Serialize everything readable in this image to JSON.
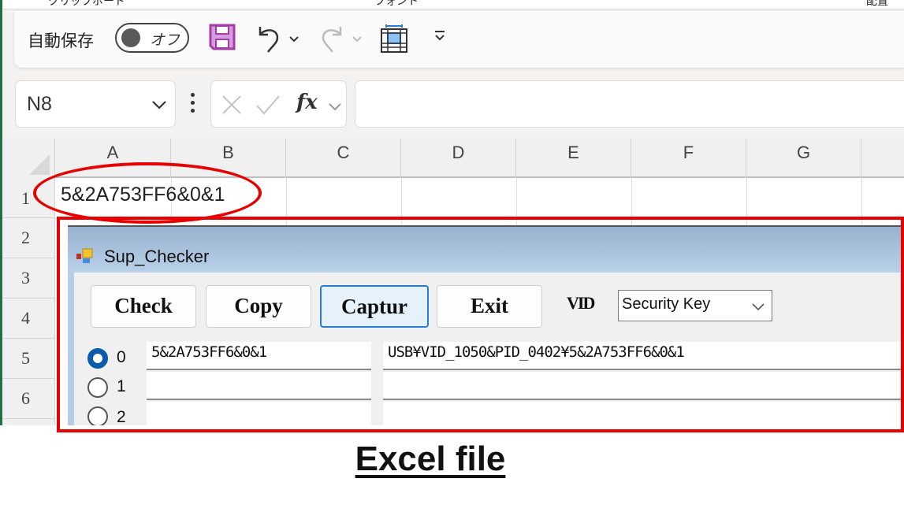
{
  "ribbon_strip": {
    "labels": [
      "クリップボード",
      "フォント",
      "配置"
    ]
  },
  "quick_access": {
    "autosave_label": "自動保存",
    "autosave_toggle_text": "オフ",
    "autosave_state": "off",
    "icons": [
      "save-icon",
      "undo-icon",
      "undo-dropdown-icon",
      "redo-icon",
      "redo-dropdown-icon",
      "freeze-panes-icon",
      "customize-toolbar-icon"
    ],
    "save_icon_color": "#a43da8"
  },
  "formula_bar": {
    "name_box": "N8",
    "fx_label": "fx",
    "formula_value": ""
  },
  "sheet": {
    "columns": [
      "A",
      "B",
      "C",
      "D",
      "E",
      "F",
      "G"
    ],
    "rows": [
      "1",
      "2",
      "3",
      "4",
      "5",
      "6"
    ],
    "cells": {
      "A1": "5&2A753FF6&0&1"
    }
  },
  "dialog": {
    "title": "Sup_Checker",
    "buttons": [
      {
        "label": "Check",
        "active": false
      },
      {
        "label": "Copy",
        "active": false
      },
      {
        "label": "Captur",
        "active": true
      },
      {
        "label": "Exit",
        "active": false
      }
    ],
    "vid_label": "VID",
    "vid_selected": "Security Key",
    "rows": [
      {
        "radio_label": "0",
        "checked": true,
        "serial": "5&2A753FF6&0&1",
        "device_path": "USB¥VID_1050&PID_0402¥5&2A753FF6&0&1"
      },
      {
        "radio_label": "1",
        "checked": false,
        "serial": "",
        "device_path": ""
      },
      {
        "radio_label": "2",
        "checked": false,
        "serial": "",
        "device_path": ""
      }
    ]
  },
  "annotation": {
    "caption": "Excel file",
    "highlight_color": "#e60000"
  }
}
